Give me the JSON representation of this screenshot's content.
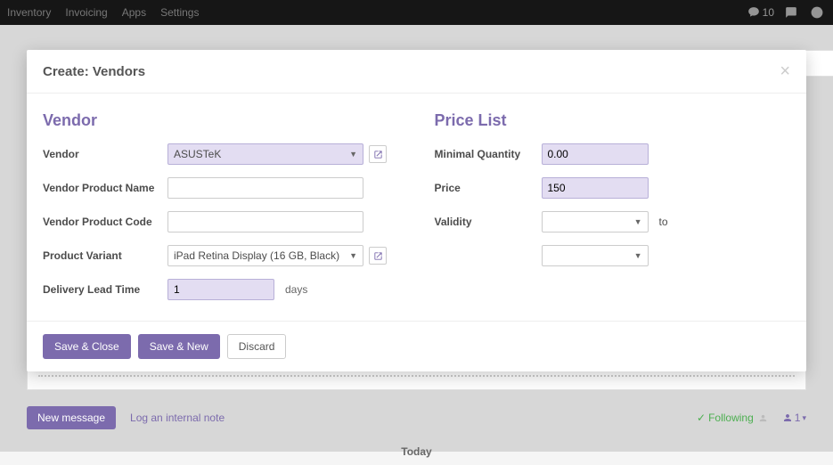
{
  "topbar": {
    "nav": [
      "Inventory",
      "Invoicing",
      "Apps",
      "Settings"
    ],
    "msg_count": "10"
  },
  "modal": {
    "title": "Create: Vendors",
    "section_vendor": "Vendor",
    "section_price": "Price List",
    "labels": {
      "vendor": "Vendor",
      "vendor_product_name": "Vendor Product Name",
      "vendor_product_code": "Vendor Product Code",
      "product_variant": "Product Variant",
      "delivery_lead_time": "Delivery Lead Time",
      "minimal_quantity": "Minimal Quantity",
      "price": "Price",
      "validity": "Validity"
    },
    "values": {
      "vendor": "ASUSTeK",
      "vendor_product_name": "",
      "vendor_product_code": "",
      "product_variant": "iPad Retina Display (16 GB, Black)",
      "delivery_lead_time": "1",
      "delivery_suffix": "days",
      "minimal_quantity": "0.00",
      "price": "150",
      "validity_from": "",
      "validity_to_label": "to",
      "validity_to": ""
    },
    "buttons": {
      "save_close": "Save & Close",
      "save_new": "Save & New",
      "discard": "Discard"
    }
  },
  "chatter": {
    "new_message": "New message",
    "internal_note": "Log an internal note",
    "following": "Following",
    "follower_count": "1",
    "today": "Today"
  }
}
